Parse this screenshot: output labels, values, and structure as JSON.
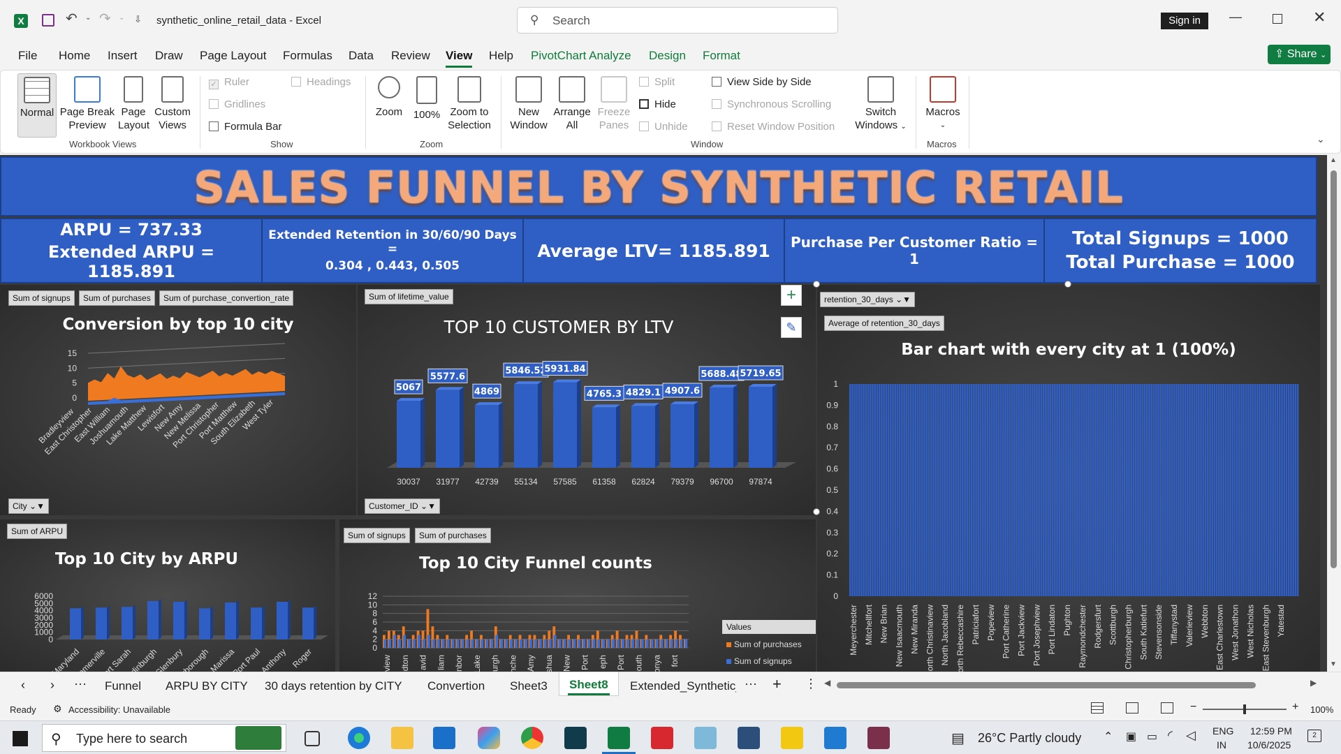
{
  "titlebar": {
    "filename": "synthetic_online_retail_data",
    "app": "-  Excel",
    "search_placeholder": "Search",
    "sign_in": "Sign in"
  },
  "menu": {
    "items": [
      "File",
      "Home",
      "Insert",
      "Draw",
      "Page Layout",
      "Formulas",
      "Data",
      "Review",
      "View",
      "Help",
      "PivotChart Analyze",
      "Design",
      "Format"
    ],
    "share": "Share"
  },
  "ribbon": {
    "workbook_views": {
      "normal": "Normal",
      "page_break": "Page Break",
      "page_break2": "Preview",
      "page_layout": "Page",
      "page_layout2": "Layout",
      "custom": "Custom",
      "custom2": "Views",
      "label": "Workbook Views"
    },
    "show": {
      "ruler": "Ruler",
      "gridlines": "Gridlines",
      "formula_bar": "Formula Bar",
      "headings": "Headings",
      "label": "Show"
    },
    "zoom": {
      "zoom": "Zoom",
      "hundred": "100%",
      "zoom_sel": "Zoom to",
      "zoom_sel2": "Selection",
      "label": "Zoom"
    },
    "window": {
      "new_window": "New",
      "new_window2": "Window",
      "arrange": "Arrange",
      "arrange2": "All",
      "freeze": "Freeze",
      "freeze2": "Panes",
      "split": "Split",
      "hide": "Hide",
      "unhide": "Unhide",
      "side": "View Side by Side",
      "sync": "Synchronous Scrolling",
      "reset": "Reset Window Position",
      "switch": "Switch",
      "switch2": "Windows",
      "label": "Window"
    },
    "macros": {
      "macros": "Macros",
      "label": "Macros"
    }
  },
  "dashboard": {
    "title": "SALES FUNNEL BY SYNTHETIC RETAIL",
    "kpis": {
      "arpu1": "ARPU  = 737.33",
      "arpu2": "Extended ARPU = 1185.891",
      "retention1": "Extended Retention in 30/60/90 Days =",
      "retention2": "0.304 , 0.443, 0.505",
      "ltv": "Average LTV= 1185.891",
      "ratio": "Purchase Per Customer Ratio  = 1",
      "signups": "Total Signups = 1000",
      "purchases": "Total Purchase = 1000"
    }
  },
  "charts": {
    "conversion": {
      "chips": [
        "Sum of signups",
        "Sum of purchases",
        "Sum of purchase_convertion_rate"
      ],
      "filter_chip": "City",
      "title": "Conversion by top 10 city",
      "y_ticks": [
        "15",
        "10",
        "5",
        "0"
      ],
      "x_labels": [
        "Bradleyview",
        "East Christopher",
        "East William",
        "Joshuamouth",
        "Lake Matthew",
        "Lewisfort",
        "New Amy",
        "New Melissa",
        "Port Christopher",
        "Port Matthew",
        "South Elizabeth",
        "West Tyler"
      ]
    },
    "ltv": {
      "chip": "Sum of lifetime_value",
      "filter_chip": "Customer_ID",
      "title": "TOP 10 CUSTOMER BY LTV"
    },
    "retention": {
      "filter_chip": "retention_30_days",
      "chip": "Average of retention_30_days",
      "title": "Bar chart with every city at 1 (100%)",
      "x_labels": [
        "Meyerchester",
        "Mitchellfort",
        "New Brian",
        "New Isaacmouth",
        "New Miranda",
        "North Christinaview",
        "North Jacobland",
        "North Rebeccashire",
        "Patriciafort",
        "Popeview",
        "Port Catherine",
        "Port Jackview",
        "Port Josephview",
        "Port Lindaton",
        "Pughton",
        "Raymondchester",
        "Rodgersfurt",
        "Scottburgh",
        "Christopherburgh",
        "South Katiefurt",
        "Stevensonside",
        "Tiffanystad",
        "Valerieview",
        "Webbton",
        "East Charlestown",
        "West Jonathon",
        "West Nicholas",
        "East Stevenburgh",
        "Yatestad"
      ]
    },
    "arpu": {
      "chip": "Sum of ARPU",
      "title": "Top 10 City by ARPU",
      "y_ticks": [
        "6000",
        "5000",
        "4000",
        "3000",
        "2000",
        "1000",
        "0"
      ],
      "x_labels": [
        "Maryland",
        "Somerville",
        "Port Sarah",
        "Edinburgh",
        "Glenbury",
        "Scarborough",
        "Marissa",
        "Port Paul",
        "Anthony",
        "Roger"
      ]
    },
    "funnel": {
      "chips": [
        "Sum of signups",
        "Sum of purchases"
      ],
      "title": "Top 10 City Funnel counts",
      "y_ticks": [
        "12",
        "10",
        "8",
        "6",
        "4",
        "2",
        "0"
      ],
      "legend_title": "Values",
      "legend": [
        "Sum of purchases",
        "Sum of signups"
      ],
      "x_labels": [
        "view",
        "dton",
        "avid",
        "liam",
        "nbor",
        "Lake",
        "urgh",
        "nche",
        "Amy",
        "shua",
        "New",
        "Port",
        "eph",
        "Port",
        "outh",
        "onya",
        "fort"
      ]
    }
  },
  "chart_data": [
    {
      "type": "bar",
      "title": "TOP 10 CUSTOMER BY LTV",
      "categories": [
        "30037",
        "31977",
        "42739",
        "55134",
        "57585",
        "61358",
        "62824",
        "79379",
        "96700",
        "97874"
      ],
      "values": [
        5067,
        5577.6,
        4869,
        5846.52,
        5931.84,
        4765.3,
        4829.1,
        4907.6,
        5688.48,
        5719.65
      ],
      "series": [
        {
          "name": "Sum of lifetime_value",
          "values": [
            5067,
            5577.6,
            4869,
            5846.52,
            5931.84,
            4765.3,
            4829.1,
            4907.6,
            5688.48,
            5719.65
          ]
        }
      ],
      "ylim": [
        0,
        6500
      ]
    },
    {
      "type": "bar",
      "title": "Bar chart with every city at 1 (100%)",
      "categories": [
        "Meyerchester",
        "Mitchellfort",
        "New Brian",
        "New Isaacmouth",
        "New Miranda",
        "North Christinaview",
        "North Jacobland",
        "North Rebeccashire",
        "Patriciafort",
        "Popeview",
        "Port Catherine",
        "Port Jackview",
        "Port Josephview",
        "Port Lindaton",
        "Pughton",
        "Raymondchester",
        "Rodgersfurt",
        "Scottburgh",
        "Christopherburgh",
        "South Katiefurt",
        "Stevensonside",
        "Tiffanystad",
        "Valerieview",
        "Webbton",
        "East Charlestown",
        "West Jonathon",
        "West Nicholas",
        "East Stevenburgh",
        "Yatestad"
      ],
      "values": [
        1,
        1,
        1,
        1,
        1,
        1,
        1,
        1,
        1,
        1,
        1,
        1,
        1,
        1,
        1,
        1,
        1,
        1,
        1,
        1,
        1,
        1,
        1,
        1,
        1,
        1,
        1,
        1,
        1
      ],
      "series": [
        {
          "name": "Average of retention_30_days",
          "values": [
            1,
            1,
            1,
            1,
            1,
            1,
            1,
            1,
            1,
            1,
            1,
            1,
            1,
            1,
            1,
            1,
            1,
            1,
            1,
            1,
            1,
            1,
            1,
            1,
            1,
            1,
            1,
            1,
            1
          ]
        }
      ],
      "y_ticks": [
        "1",
        "0.9",
        "0.8",
        "0.7",
        "0.6",
        "0.5",
        "0.4",
        "0.3",
        "0.2",
        "0.1",
        "0"
      ],
      "ylim": [
        0,
        1
      ]
    },
    {
      "type": "bar",
      "title": "Top 10 City by ARPU",
      "categories": [
        "Maryland",
        "Somerville",
        "Port Sarah",
        "Edinburgh",
        "Glenbury",
        "Scarborough",
        "Marissa",
        "Port Paul",
        "Anthony",
        "Roger"
      ],
      "values": [
        5100,
        5200,
        5300,
        6100,
        6000,
        5100,
        5900,
        5200,
        6000,
        5200
      ],
      "series": [
        {
          "name": "Sum of ARPU",
          "values": [
            5100,
            5200,
            5300,
            6100,
            6000,
            5100,
            5900,
            5200,
            6000,
            5200
          ]
        }
      ],
      "ylim": [
        0,
        6000
      ]
    },
    {
      "type": "bar",
      "title": "Top 10 City Funnel counts",
      "series": [
        {
          "name": "Sum of purchases",
          "values": [
            3,
            4,
            4,
            3,
            5,
            2,
            3,
            4,
            4,
            9,
            5,
            3,
            2,
            3,
            2,
            2,
            2,
            3,
            4,
            2,
            3,
            2,
            2,
            5,
            2,
            2,
            3,
            2,
            3,
            2,
            3,
            3,
            2,
            3,
            4,
            5,
            2,
            2,
            3,
            2,
            3,
            2,
            2,
            3,
            4,
            2,
            2,
            3,
            4,
            2,
            3,
            3,
            4,
            2,
            3,
            2,
            2,
            3,
            2,
            3,
            4,
            3,
            2
          ]
        },
        {
          "name": "Sum of signups",
          "values": [
            2,
            2,
            3,
            2,
            3,
            2,
            2,
            3,
            2,
            3,
            2,
            2,
            2,
            2,
            2,
            2,
            2,
            2,
            2,
            2,
            2,
            2,
            2,
            3,
            2,
            2,
            2,
            2,
            2,
            2,
            2,
            2,
            2,
            2,
            2,
            3,
            2,
            2,
            2,
            2,
            2,
            2,
            2,
            2,
            2,
            2,
            2,
            2,
            2,
            2,
            2,
            2,
            2,
            2,
            2,
            2,
            2,
            2,
            2,
            2,
            2,
            2,
            2
          ]
        }
      ],
      "ylim": [
        0,
        12
      ]
    },
    {
      "type": "area",
      "title": "Conversion by top 10 city",
      "series": [
        {
          "name": "Sum of signups",
          "values": [
            1,
            1,
            1,
            1,
            2,
            1,
            1,
            1,
            1,
            1,
            1,
            1,
            1,
            1,
            1,
            1,
            1,
            1,
            1,
            1,
            1,
            1,
            1,
            1,
            1,
            1,
            1,
            1,
            1,
            1,
            1
          ]
        },
        {
          "name": "Sum of purchases",
          "values": [
            6,
            7,
            6,
            9,
            7,
            11,
            8,
            7,
            8,
            6,
            7,
            8,
            6,
            7,
            6,
            8,
            7,
            6,
            7,
            8,
            6,
            7,
            6,
            7,
            8,
            6,
            7,
            6,
            7,
            6,
            5
          ]
        },
        {
          "name": "Sum of purchase_convertion_rate",
          "values": [
            2,
            2,
            3,
            3,
            4,
            6,
            4,
            3,
            3,
            3,
            2,
            3,
            2,
            3,
            2,
            3,
            2,
            2,
            3,
            3,
            2,
            2,
            2,
            2,
            3,
            2,
            2,
            2,
            2,
            2,
            2
          ]
        }
      ],
      "ylim": [
        0,
        15
      ]
    }
  ],
  "sheet_tabs": [
    "Funnel",
    "ARPU BY CITY",
    "30 days retention by CITY",
    "Convertion",
    "Sheet3",
    "Sheet8",
    "Extended_Synthetic_"
  ],
  "active_tab": "Sheet8",
  "status": {
    "ready": "Ready",
    "accessibility": "Accessibility: Unavailable",
    "zoom": "100%"
  },
  "taskbar": {
    "search_placeholder": "Type here to search",
    "weather": "26°C  Partly cloudy",
    "lang1": "ENG",
    "lang2": "IN",
    "time": "12:59 PM",
    "date": "10/6/2025",
    "notif": "2"
  }
}
